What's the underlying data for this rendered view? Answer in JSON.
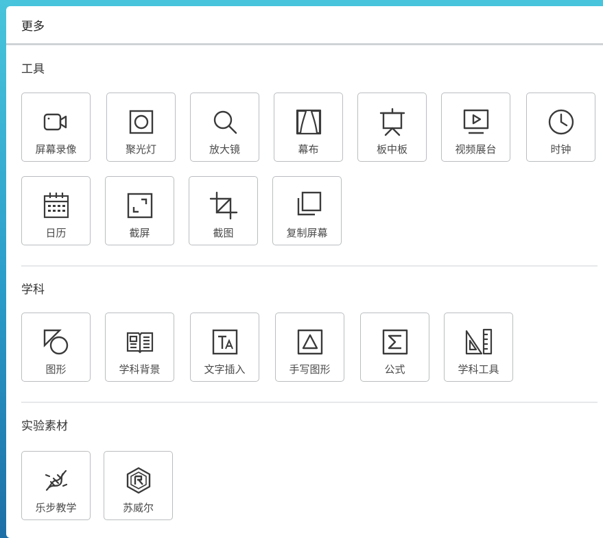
{
  "panel": {
    "title": "更多"
  },
  "sections": [
    {
      "title": "工具",
      "items": [
        {
          "label": "屏幕录像",
          "icon": "camera-icon"
        },
        {
          "label": "聚光灯",
          "icon": "spotlight-icon"
        },
        {
          "label": "放大镜",
          "icon": "magnifier-icon"
        },
        {
          "label": "幕布",
          "icon": "curtain-icon"
        },
        {
          "label": "板中板",
          "icon": "easel-icon"
        },
        {
          "label": "视频展台",
          "icon": "video-booth-icon"
        },
        {
          "label": "时钟",
          "icon": "clock-icon"
        },
        {
          "label": "日历",
          "icon": "calendar-icon"
        },
        {
          "label": "截屏",
          "icon": "screenshot-icon"
        },
        {
          "label": "截图",
          "icon": "crop-icon"
        },
        {
          "label": "复制屏幕",
          "icon": "copy-screen-icon"
        }
      ]
    },
    {
      "title": "学科",
      "items": [
        {
          "label": "图形",
          "icon": "shapes-icon"
        },
        {
          "label": "学科背景",
          "icon": "book-icon"
        },
        {
          "label": "文字插入",
          "icon": "text-box-icon"
        },
        {
          "label": "手写图形",
          "icon": "triangle-icon"
        },
        {
          "label": "公式",
          "icon": "sigma-icon"
        },
        {
          "label": "学科工具",
          "icon": "ruler-icon"
        }
      ]
    },
    {
      "title": "实验素材",
      "items": [
        {
          "label": "乐步教学",
          "icon": "dna-icon"
        },
        {
          "label": "苏威尔",
          "icon": "hexagon-logo-icon"
        }
      ]
    }
  ],
  "colors": {
    "icon": "#3a3a3a",
    "border": "#b9bcbf",
    "accent_bg": "#3fb6d6"
  }
}
